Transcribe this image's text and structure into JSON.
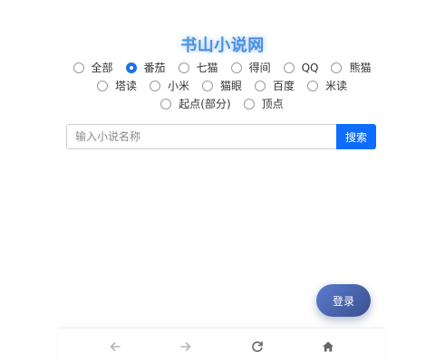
{
  "site": {
    "title": "书山小说网"
  },
  "sources": {
    "selected": "番茄",
    "options": [
      {
        "label": "全部"
      },
      {
        "label": "番茄"
      },
      {
        "label": "七猫"
      },
      {
        "label": "得间"
      },
      {
        "label": "QQ"
      },
      {
        "label": "熊猫"
      },
      {
        "label": "塔读"
      },
      {
        "label": "小米"
      },
      {
        "label": "猫眼"
      },
      {
        "label": "百度"
      },
      {
        "label": "米读"
      },
      {
        "label": "起点(部分)"
      },
      {
        "label": "顶点"
      }
    ]
  },
  "search": {
    "placeholder": "输入小说名称",
    "value": "",
    "button_label": "搜索"
  },
  "login": {
    "label": "登录"
  },
  "nav": {
    "items": [
      {
        "icon": "back-arrow-icon"
      },
      {
        "icon": "forward-arrow-icon"
      },
      {
        "icon": "refresh-icon"
      },
      {
        "icon": "home-icon"
      }
    ]
  },
  "colors": {
    "title": "#4a90e2",
    "accent": "#0d6efd",
    "radio_checked": "#1a73e8",
    "login_gradient_start": "#5b7ccf",
    "login_gradient_end": "#3a4f8f",
    "nav_icon_disabled": "#b5b5b5",
    "nav_icon_active": "#666666"
  }
}
